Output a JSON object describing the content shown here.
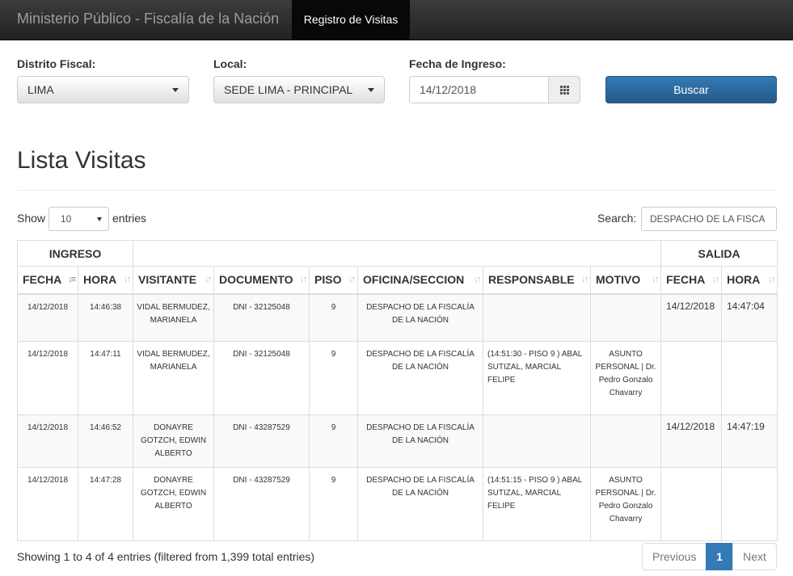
{
  "navbar": {
    "brand": "Ministerio Público - Fiscalía de la Nación",
    "active_tab": "Registro de Visitas"
  },
  "filters": {
    "distrito_label": "Distrito Fiscal:",
    "distrito_value": "LIMA",
    "local_label": "Local:",
    "local_value": "SEDE LIMA - PRINCIPAL",
    "fecha_label": "Fecha de Ingreso:",
    "fecha_value": "14/12/2018",
    "buscar_label": "Buscar"
  },
  "page_title": "Lista Visitas",
  "table_controls": {
    "show_label": "Show",
    "entries_value": "10",
    "entries_label": "entries",
    "search_label": "Search:",
    "search_value": "DESPACHO DE LA FISCA"
  },
  "table": {
    "group_ingreso": "INGRESO",
    "group_salida": "SALIDA",
    "headers": [
      "FECHA",
      "HORA",
      "VISITANTE",
      "DOCUMENTO",
      "PISO",
      "OFICINA/SECCION",
      "RESPONSABLE",
      "MOTIVO",
      "FECHA",
      "HORA"
    ],
    "rows": [
      {
        "fecha": "14/12/2018",
        "hora": "14:46:38",
        "visitante": "VIDAL BERMUDEZ, MARIANELA",
        "documento": "DNI - 32125048",
        "piso": "9",
        "oficina": "DESPACHO DE LA FISCALÍA DE LA NACIÓN",
        "responsable": "",
        "motivo": "",
        "salida_fecha": "14/12/2018",
        "salida_hora": "14:47:04"
      },
      {
        "fecha": "14/12/2018",
        "hora": "14:47:11",
        "visitante": "VIDAL BERMUDEZ, MARIANELA",
        "documento": "DNI - 32125048",
        "piso": "9",
        "oficina": "DESPACHO DE LA FISCALÍA DE LA NACIÓN",
        "responsable": "(14:51:30 - PISO 9 ) ABAL SUTIZAL, MARCIAL FELIPE",
        "motivo": "ASUNTO PERSONAL | Dr. Pedro Gonzalo Chavarry",
        "salida_fecha": "",
        "salida_hora": ""
      },
      {
        "fecha": "14/12/2018",
        "hora": "14:46:52",
        "visitante": "DONAYRE GOTZCH, EDWIN ALBERTO",
        "documento": "DNI - 43287529",
        "piso": "9",
        "oficina": "DESPACHO DE LA FISCALÍA DE LA NACIÓN",
        "responsable": "",
        "motivo": "",
        "salida_fecha": "14/12/2018",
        "salida_hora": "14:47:19"
      },
      {
        "fecha": "14/12/2018",
        "hora": "14:47:28",
        "visitante": "DONAYRE GOTZCH, EDWIN ALBERTO",
        "documento": "DNI - 43287529",
        "piso": "9",
        "oficina": "DESPACHO DE LA FISCALÍA DE LA NACIÓN",
        "responsable": "(14:51:15 - PISO 9 ) ABAL SUTIZAL, MARCIAL FELIPE",
        "motivo": "ASUNTO PERSONAL | Dr. Pedro Gonzalo Chavarry",
        "salida_fecha": "",
        "salida_hora": ""
      }
    ]
  },
  "footer": {
    "info": "Showing 1 to 4 of 4 entries (filtered from 1,399 total entries)",
    "prev_label": "Previous",
    "current_page": "1",
    "next_label": "Next"
  },
  "icons": {
    "date_addon": "calendar-grid-icon",
    "sort": "sort-icon",
    "caret": "caret-down-icon"
  },
  "colors": {
    "navbar": "#222222",
    "primary": "#337ab7"
  }
}
